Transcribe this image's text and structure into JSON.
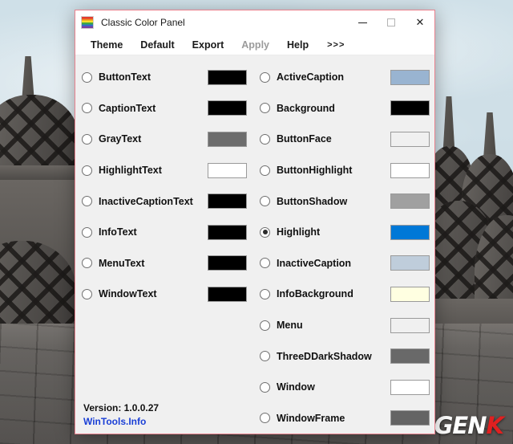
{
  "window": {
    "title": "Classic Color Panel",
    "icon": "rainbow-flag-icon",
    "border_color": "#e8818d",
    "controls": {
      "minimize": "minimize-icon",
      "maximize": "maximize-icon",
      "close": "close-icon"
    }
  },
  "menu": {
    "items": [
      {
        "label": "Theme",
        "disabled": false
      },
      {
        "label": "Default",
        "disabled": false
      },
      {
        "label": "Export",
        "disabled": false
      },
      {
        "label": "Apply",
        "disabled": true
      },
      {
        "label": "Help",
        "disabled": false
      },
      {
        "label": ">>>",
        "disabled": false
      }
    ]
  },
  "left_column": [
    {
      "label": "ButtonText",
      "color": "#000000",
      "selected": false
    },
    {
      "label": "CaptionText",
      "color": "#000000",
      "selected": false
    },
    {
      "label": "GrayText",
      "color": "#6d6d6d",
      "selected": false
    },
    {
      "label": "HighlightText",
      "color": "#ffffff",
      "selected": false
    },
    {
      "label": "InactiveCaptionText",
      "color": "#000000",
      "selected": false
    },
    {
      "label": "InfoText",
      "color": "#000000",
      "selected": false
    },
    {
      "label": "MenuText",
      "color": "#000000",
      "selected": false
    },
    {
      "label": "WindowText",
      "color": "#000000",
      "selected": false
    }
  ],
  "right_column": [
    {
      "label": "ActiveCaption",
      "color": "#99b4d1",
      "selected": false
    },
    {
      "label": "Background",
      "color": "#000000",
      "selected": false
    },
    {
      "label": "ButtonFace",
      "color": "#f0f0f0",
      "selected": false
    },
    {
      "label": "ButtonHighlight",
      "color": "#ffffff",
      "selected": false
    },
    {
      "label": "ButtonShadow",
      "color": "#a0a0a0",
      "selected": false
    },
    {
      "label": "Highlight",
      "color": "#0078d7",
      "selected": true
    },
    {
      "label": "InactiveCaption",
      "color": "#bfcddb",
      "selected": false
    },
    {
      "label": "InfoBackground",
      "color": "#ffffe1",
      "selected": false
    },
    {
      "label": "Menu",
      "color": "#f0f0f0",
      "selected": false
    },
    {
      "label": "ThreeDDarkShadow",
      "color": "#696969",
      "selected": false
    },
    {
      "label": "Window",
      "color": "#ffffff",
      "selected": false
    },
    {
      "label": "WindowFrame",
      "color": "#646464",
      "selected": false
    }
  ],
  "footer": {
    "version": "Version: 1.0.0.27",
    "link": "WinTools.Info",
    "link_color": "#1a3fd6"
  },
  "watermark": {
    "part1": "GEN",
    "part2": "K",
    "part1_color": "#ffffff",
    "part2_color": "#e02020"
  }
}
